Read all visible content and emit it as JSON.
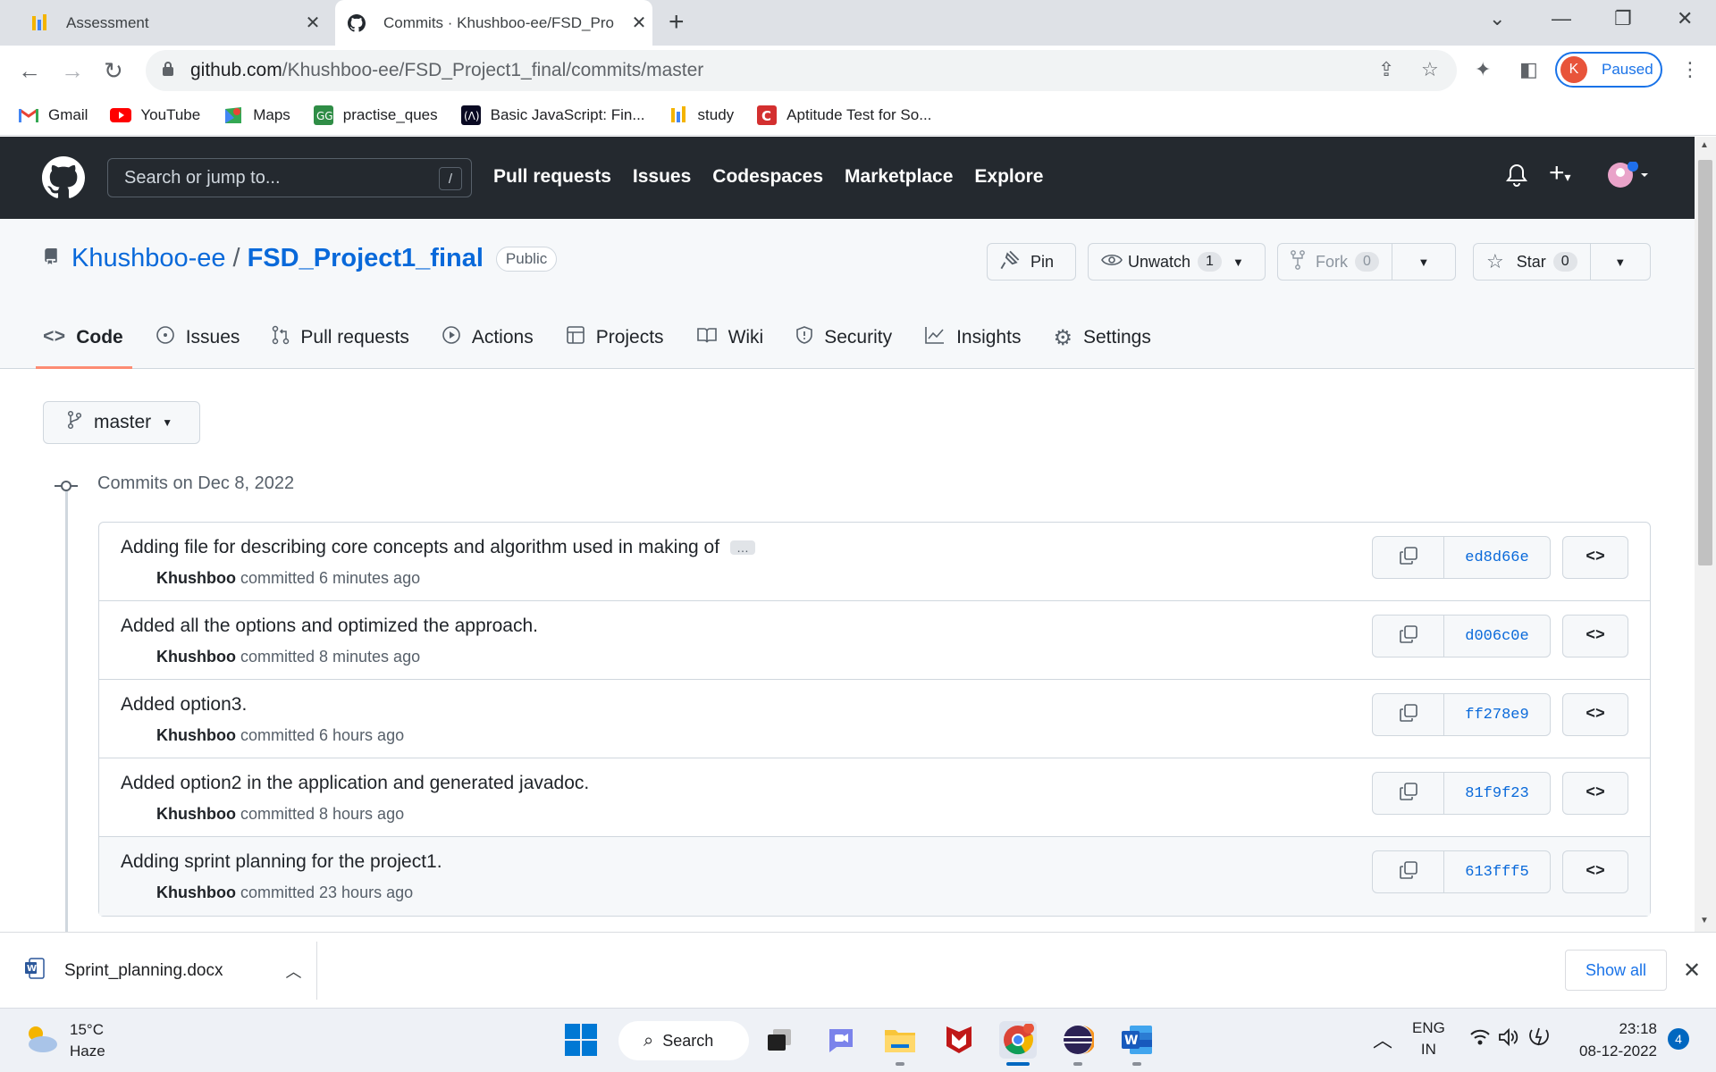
{
  "browser": {
    "tabs": [
      {
        "title": "Assessment",
        "active": false
      },
      {
        "title": "Commits · Khushboo-ee/FSD_Pro",
        "active": true
      }
    ],
    "url_host": "github.com",
    "url_path": "/Khushboo-ee/FSD_Project1_final/commits/master",
    "profile_initial": "K",
    "profile_status": "Paused",
    "bookmarks": [
      "Gmail",
      "YouTube",
      "Maps",
      "practise_ques",
      "Basic JavaScript: Fin...",
      "study",
      "Aptitude Test for So..."
    ]
  },
  "github": {
    "search_placeholder": "Search or jump to...",
    "search_shortcut": "/",
    "nav": [
      "Pull requests",
      "Issues",
      "Codespaces",
      "Marketplace",
      "Explore"
    ]
  },
  "repo": {
    "owner": "Khushboo-ee",
    "separator": "/",
    "name": "FSD_Project1_final",
    "visibility": "Public",
    "pin_label": "Pin",
    "watch_label": "Unwatch",
    "watch_count": "1",
    "fork_label": "Fork",
    "fork_count": "0",
    "star_label": "Star",
    "star_count": "0",
    "tabs": [
      "Code",
      "Issues",
      "Pull requests",
      "Actions",
      "Projects",
      "Wiki",
      "Security",
      "Insights",
      "Settings"
    ],
    "active_tab": "Code"
  },
  "commits_page": {
    "branch": "master",
    "date_heading": "Commits on Dec 8, 2022",
    "commits": [
      {
        "message": "Adding file for describing core concepts and algorithm used in making of",
        "truncated": true,
        "author": "Khushboo",
        "time": "committed 6 minutes ago",
        "sha": "ed8d66e"
      },
      {
        "message": "Added all the options and optimized the approach.",
        "truncated": false,
        "author": "Khushboo",
        "time": "committed 8 minutes ago",
        "sha": "d006c0e"
      },
      {
        "message": "Added option3.",
        "truncated": false,
        "author": "Khushboo",
        "time": "committed 6 hours ago",
        "sha": "ff278e9"
      },
      {
        "message": "Added option2 in the application and generated javadoc.",
        "truncated": false,
        "author": "Khushboo",
        "time": "committed 8 hours ago",
        "sha": "81f9f23"
      },
      {
        "message": "Adding sprint planning for the project1.",
        "truncated": false,
        "author": "Khushboo",
        "time": "committed 23 hours ago",
        "sha": "613fff5"
      }
    ],
    "ellipsis": "…",
    "browse_label": "<>"
  },
  "download_bar": {
    "file": "Sprint_planning.docx",
    "show_all": "Show all"
  },
  "taskbar": {
    "temperature": "15°C",
    "condition": "Haze",
    "search": "Search",
    "lang1": "ENG",
    "lang2": "IN",
    "time": "23:18",
    "date": "08-12-2022",
    "notifications": "4"
  }
}
